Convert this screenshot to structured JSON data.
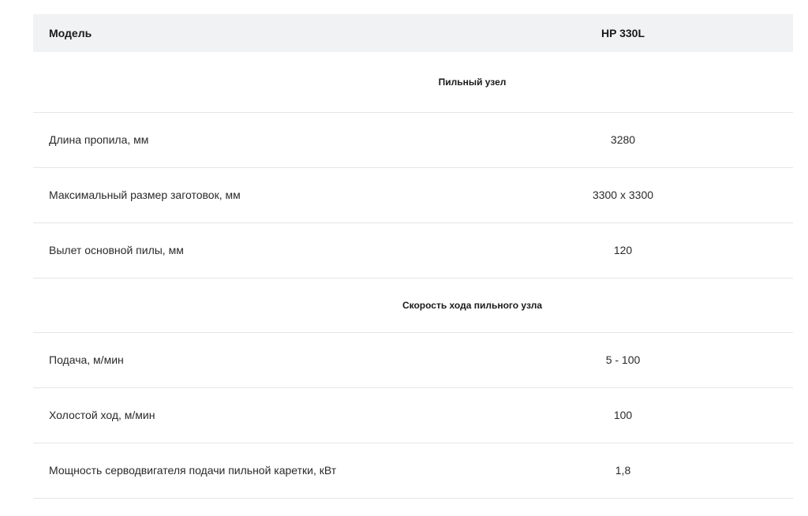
{
  "table": {
    "header": {
      "name": "Модель",
      "value": "HP 330L"
    },
    "sections": [
      {
        "title": "Пильный узел",
        "rows": [
          {
            "name": "Длина пропила, мм",
            "value": "3280"
          },
          {
            "name": "Максимальный размер заготовок, мм",
            "value": "3300 x 3300"
          },
          {
            "name": "Вылет основной пилы, мм",
            "value": "120"
          }
        ]
      },
      {
        "title": "Скорость хода пильного узла",
        "rows": [
          {
            "name": "Подача, м/мин",
            "value": "5 - 100"
          },
          {
            "name": "Холостой ход, м/мин",
            "value": "100"
          },
          {
            "name": "Мощность серводвигателя подачи пильной каретки, кВт",
            "value": "1,8"
          }
        ]
      }
    ]
  }
}
